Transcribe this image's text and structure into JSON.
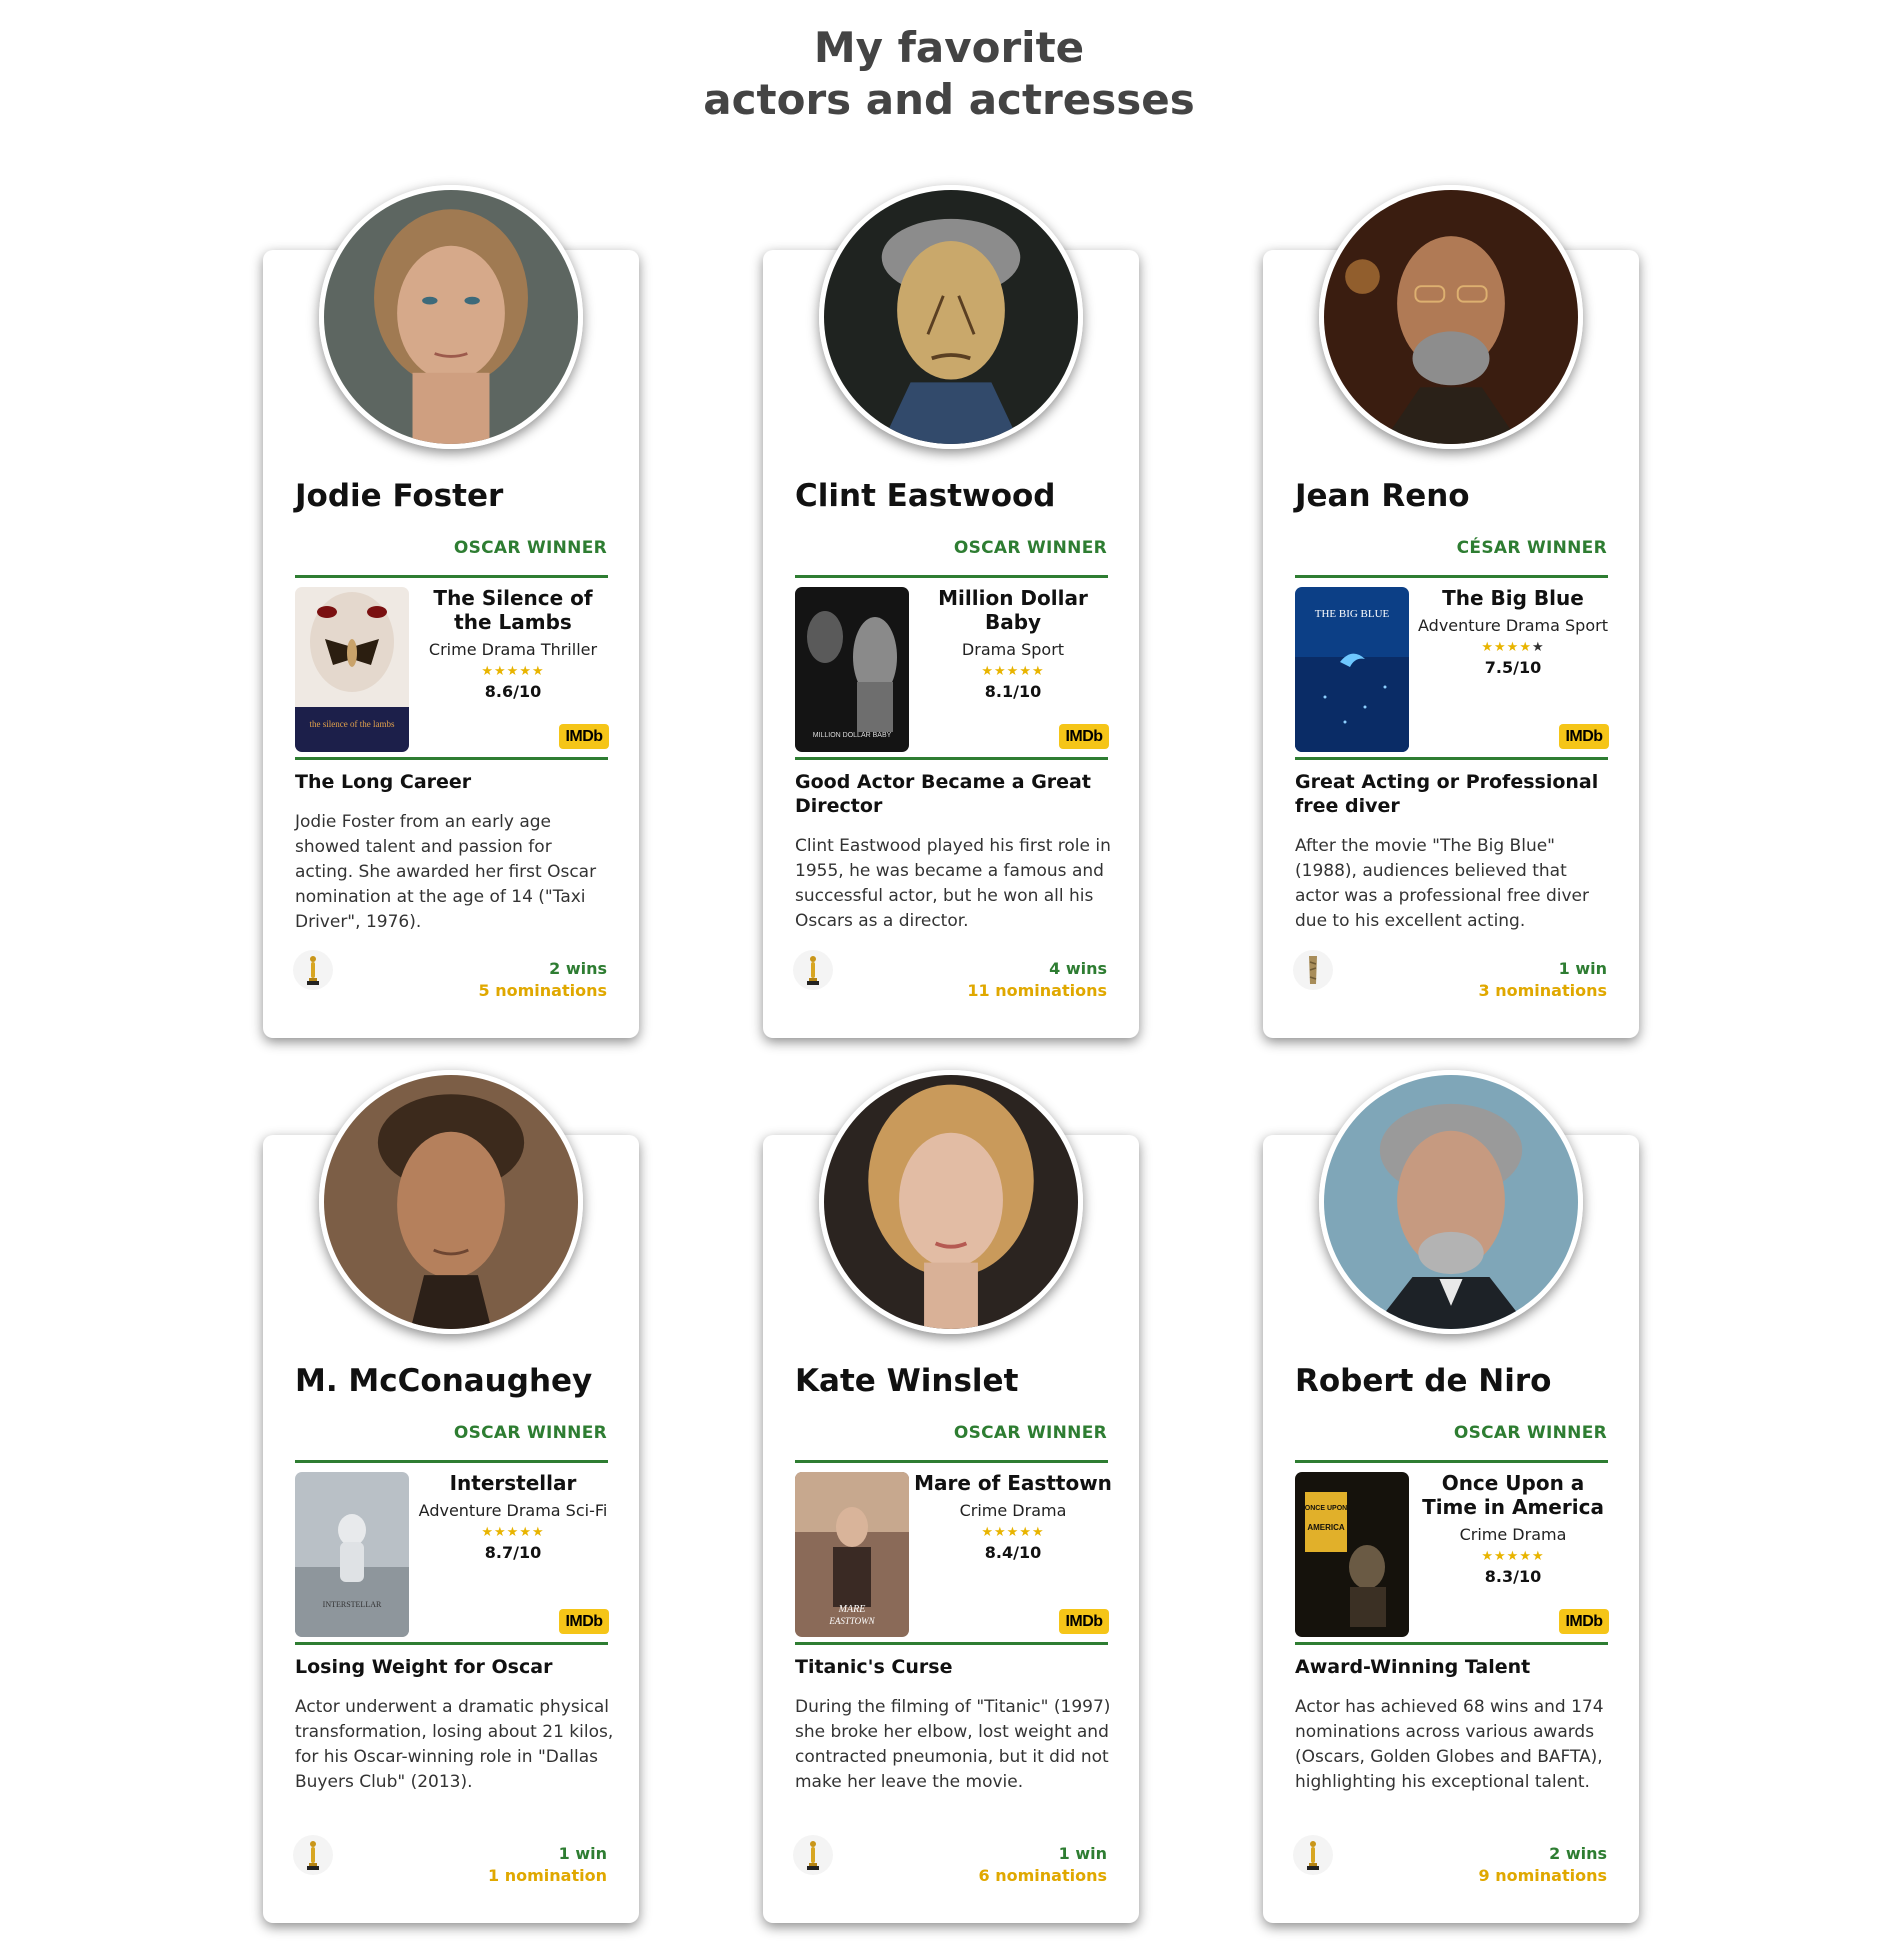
{
  "page": {
    "title_line1": "My favorite",
    "title_line2": "actors and actresses"
  },
  "colors": {
    "accent_green": "#2e7d32",
    "nominations_gold": "#e0a800",
    "imdb_yellow": "#f5c518",
    "star_gold": "#e8b400"
  },
  "actors": [
    {
      "name": "Jodie Foster",
      "award": "OSCAR WINNER",
      "movie": {
        "title": "The Silence of the Lambs",
        "genres": "Crime Drama Thriller",
        "stars": 5,
        "rating": "8.6/10"
      },
      "imdb_label": "IMDb",
      "story_title": "The Long Career",
      "story": "Jodie Foster from an early age showed talent and passion for acting. She awarded her first Oscar nomination at the age of 14 (\"Taxi Driver\", 1976).",
      "wins": "2 wins",
      "nominations": "5 nominations",
      "trophy_icon": "oscar-statuette-icon"
    },
    {
      "name": "Clint Eastwood",
      "award": "OSCAR WINNER",
      "movie": {
        "title": "Million Dollar Baby",
        "genres": "Drama Sport",
        "stars": 5,
        "rating": "8.1/10"
      },
      "imdb_label": "IMDb",
      "story_title": "Good Actor Became a Great Director",
      "story": "Clint Eastwood played his first role in 1955, he was became a famous and successful actor, but he won all his Oscars as a director.",
      "wins": "4 wins",
      "nominations": "11 nominations",
      "trophy_icon": "oscar-statuette-icon"
    },
    {
      "name": "Jean Reno",
      "award": "CÉSAR WINNER",
      "movie": {
        "title": "The Big Blue",
        "genres": "Adventure Drama Sport",
        "stars": 4,
        "rating": "7.5/10"
      },
      "imdb_label": "IMDb",
      "story_title": "Great Acting or Professional free diver",
      "story": "After the movie \"The Big Blue\" (1988), audiences believed that actor was a professional free diver due to his excellent acting.",
      "wins": "1 win",
      "nominations": "3 nominations",
      "trophy_icon": "cesar-statuette-icon"
    },
    {
      "name": "M. McConaughey",
      "award": "OSCAR WINNER",
      "movie": {
        "title": "Interstellar",
        "genres": "Adventure Drama Sci-Fi",
        "stars": 5,
        "rating": "8.7/10"
      },
      "imdb_label": "IMDb",
      "story_title": "Losing Weight for Oscar",
      "story": "Actor underwent a dramatic physical transformation, losing about 21 kilos, for his Oscar-winning role in \"Dallas Buyers Club\" (2013).",
      "wins": "1 win",
      "nominations": "1 nomination",
      "trophy_icon": "oscar-statuette-icon"
    },
    {
      "name": "Kate Winslet",
      "award": "OSCAR WINNER",
      "movie": {
        "title": "Mare of Easttown",
        "genres": "Crime Drama",
        "stars": 5,
        "rating": "8.4/10"
      },
      "imdb_label": "IMDb",
      "story_title": "Titanic's Curse",
      "story": "During the filming of \"Titanic\" (1997) she broke her elbow, lost weight and contracted pneumonia, but it did not make her leave the movie.",
      "wins": "1 win",
      "nominations": "6 nominations",
      "trophy_icon": "oscar-statuette-icon"
    },
    {
      "name": "Robert de Niro",
      "award": "OSCAR WINNER",
      "movie": {
        "title": "Once Upon a Time in America",
        "genres": "Crime Drama",
        "stars": 5,
        "rating": "8.3/10"
      },
      "imdb_label": "IMDb",
      "story_title": "Award-Winning Talent",
      "story": "Actor has achieved 68 wins and 174 nominations across various awards (Oscars, Golden Globes and BAFTA), highlighting his exceptional talent.",
      "wins": "2 wins",
      "nominations": "9 nominations",
      "trophy_icon": "oscar-statuette-icon"
    }
  ]
}
